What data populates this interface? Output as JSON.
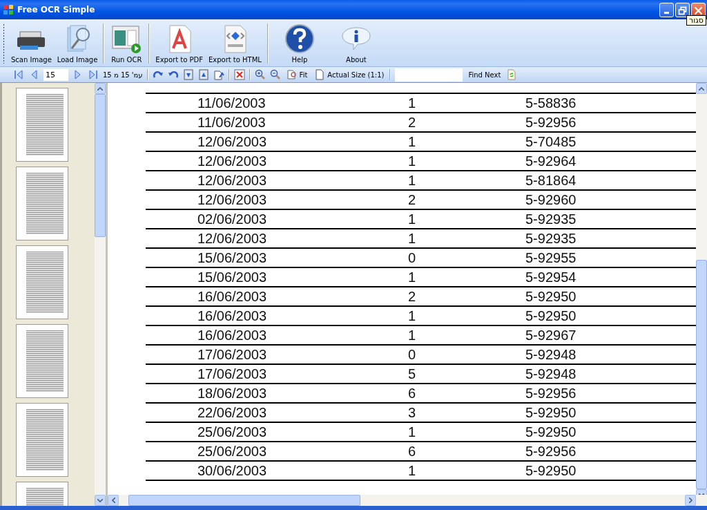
{
  "window": {
    "title": "Free OCR Simple",
    "tooltip": "סגור"
  },
  "toolbar": [
    {
      "kind": "scan",
      "label": "Scan Image"
    },
    {
      "kind": "load",
      "label": "Load Image"
    },
    {
      "kind": "separator"
    },
    {
      "kind": "run",
      "label": "Run OCR"
    },
    {
      "kind": "separator"
    },
    {
      "kind": "pdf",
      "label": "Export to PDF"
    },
    {
      "kind": "xaml",
      "label": "Export to HTML"
    },
    {
      "kind": "separator"
    },
    {
      "kind": "help",
      "label": "Help"
    },
    {
      "kind": "about",
      "label": "About"
    }
  ],
  "navbar": [
    {
      "kind": "first"
    },
    {
      "kind": "prev"
    },
    {
      "kind": "page-input",
      "value": "15"
    },
    {
      "kind": "next"
    },
    {
      "kind": "last"
    },
    {
      "kind": "label",
      "text": "עמ' 15 מ 15"
    },
    {
      "kind": "sep"
    },
    {
      "kind": "rotate-right"
    },
    {
      "kind": "rotate-left"
    },
    {
      "kind": "move-down"
    },
    {
      "kind": "move-up"
    },
    {
      "kind": "export-page"
    },
    {
      "kind": "sep"
    },
    {
      "kind": "delete"
    },
    {
      "kind": "sep"
    },
    {
      "kind": "zoom-in"
    },
    {
      "kind": "zoom-out"
    },
    {
      "kind": "fit",
      "text": "Fit"
    },
    {
      "kind": "actual",
      "text": "Actual Size (1:1)"
    },
    {
      "kind": "sep"
    },
    {
      "kind": "search"
    },
    {
      "kind": "find",
      "text": "Find Next"
    },
    {
      "kind": "refresh"
    }
  ],
  "thumbnails": [
    {
      "kind": "page"
    },
    {
      "kind": "page"
    },
    {
      "kind": "page"
    },
    {
      "kind": "page"
    },
    {
      "kind": "page"
    },
    {
      "kind": "page"
    }
  ],
  "document": {
    "rows": [
      [
        "11/06/2003",
        "1",
        "5-58836"
      ],
      [
        "11/06/2003",
        "2",
        "5-92956"
      ],
      [
        "12/06/2003",
        "1",
        "5-70485"
      ],
      [
        "12/06/2003",
        "1",
        "5-92964"
      ],
      [
        "12/06/2003",
        "1",
        "5-81864"
      ],
      [
        "12/06/2003",
        "2",
        "5-92960"
      ],
      [
        "02/06/2003",
        "1",
        "5-92935"
      ],
      [
        "12/06/2003",
        "1",
        "5-92935"
      ],
      [
        "15/06/2003",
        "0",
        "5-92955"
      ],
      [
        "15/06/2003",
        "1",
        "5-92954"
      ],
      [
        "16/06/2003",
        "2",
        "5-92950"
      ],
      [
        "16/06/2003",
        "1",
        "5-92950"
      ],
      [
        "16/06/2003",
        "1",
        "5-92967"
      ],
      [
        "17/06/2003",
        "0",
        "5-92948"
      ],
      [
        "17/06/2003",
        "5",
        "5-92948"
      ],
      [
        "18/06/2003",
        "6",
        "5-92956"
      ],
      [
        "22/06/2003",
        "3",
        "5-92950"
      ],
      [
        "25/06/2003",
        "1",
        "5-92950"
      ],
      [
        "25/06/2003",
        "6",
        "5-92956"
      ],
      [
        "30/06/2003",
        "1",
        "5-92950"
      ]
    ]
  }
}
